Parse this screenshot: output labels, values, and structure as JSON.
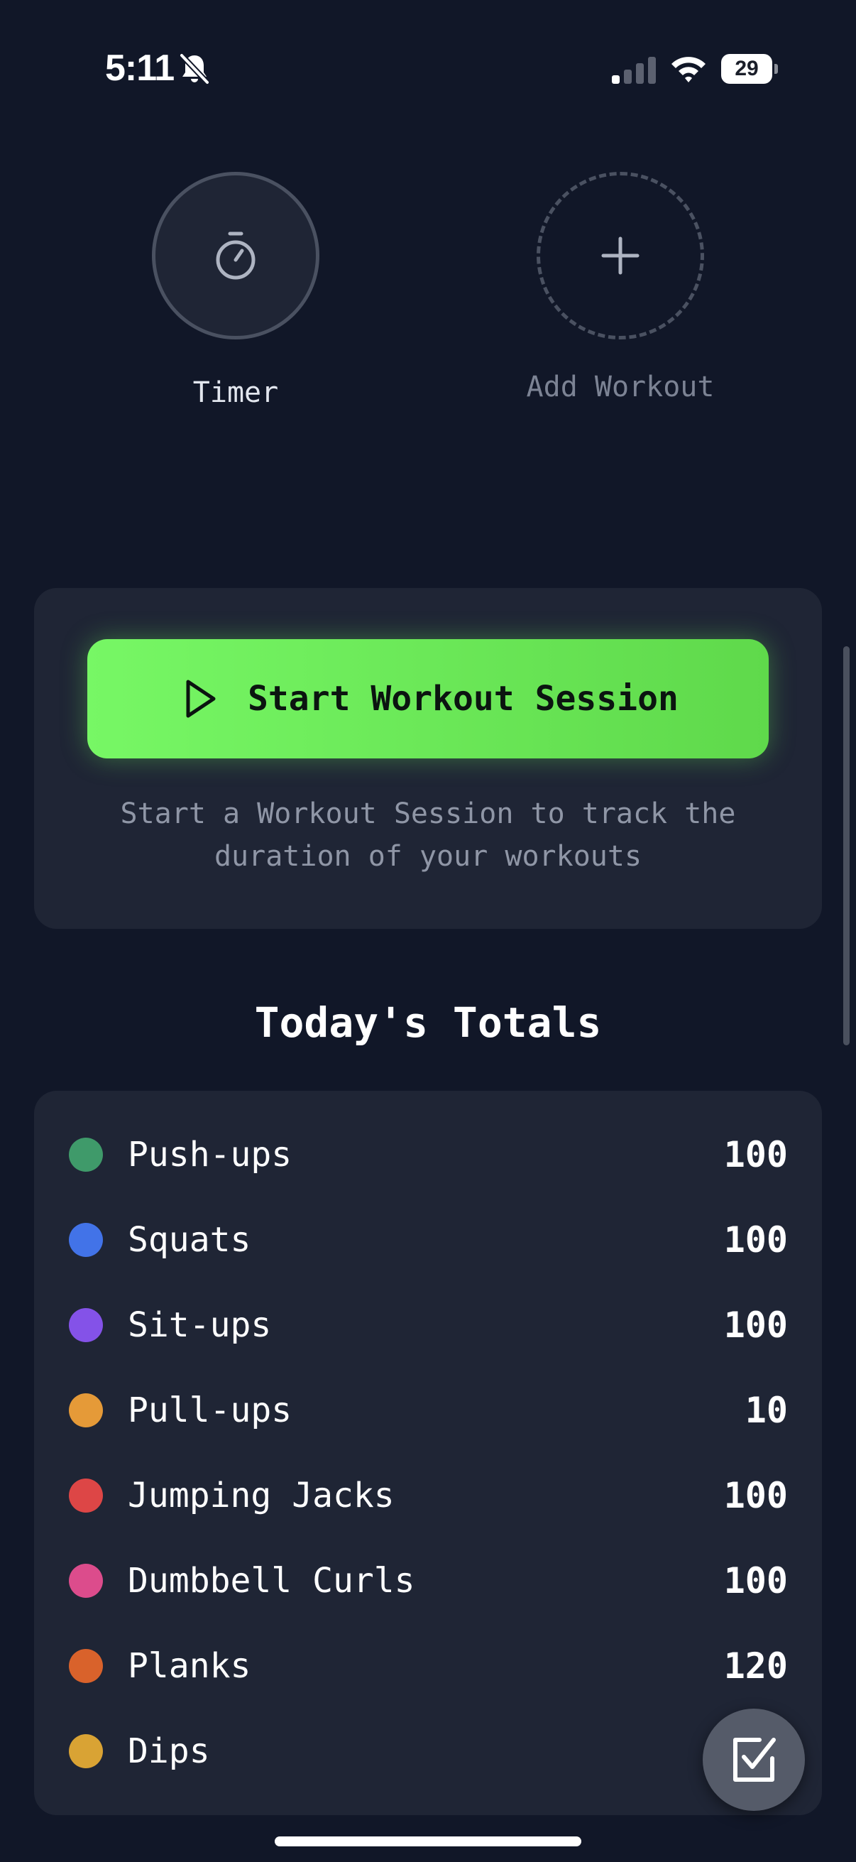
{
  "status_bar": {
    "time": "5:11",
    "battery_level": "29",
    "icons": [
      "bell-slash-icon",
      "signal-icon",
      "wifi-icon",
      "battery-icon"
    ]
  },
  "quick_actions": {
    "timer_label": "Timer",
    "timer_icon": "stopwatch-icon",
    "add_label": "Add Workout",
    "add_icon": "plus-icon"
  },
  "session": {
    "button_label": "Start Workout Session",
    "button_icon": "play-icon",
    "hint": "Start a Workout Session to track the duration of your workouts"
  },
  "totals": {
    "title": "Today's Totals",
    "items": [
      {
        "name": "Push-ups",
        "total": "100",
        "color": "#3f9a6a"
      },
      {
        "name": "Squats",
        "total": "100",
        "color": "#4273e8"
      },
      {
        "name": "Sit-ups",
        "total": "100",
        "color": "#8452e8"
      },
      {
        "name": "Pull-ups",
        "total": "10",
        "color": "#e59a38"
      },
      {
        "name": "Jumping Jacks",
        "total": "100",
        "color": "#dd4646"
      },
      {
        "name": "Dumbbell Curls",
        "total": "100",
        "color": "#dc4c8c"
      },
      {
        "name": "Planks",
        "total": "120",
        "color": "#d9622b"
      },
      {
        "name": "Dips",
        "total": "",
        "color": "#d9a334"
      }
    ]
  },
  "fab_icon": "checklist-icon",
  "colors": {
    "background": "#111728",
    "card": "#1f2535",
    "accent": "#6ee85a"
  }
}
